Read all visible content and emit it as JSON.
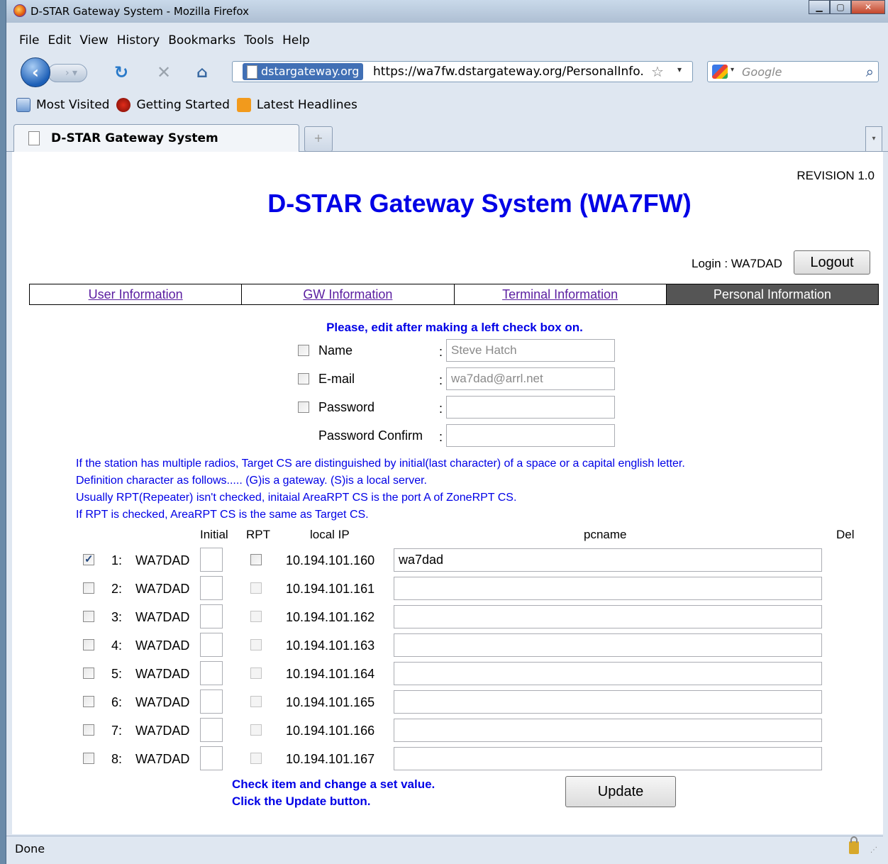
{
  "window": {
    "title": "D-STAR Gateway System - Mozilla Firefox"
  },
  "menu": [
    "File",
    "Edit",
    "View",
    "History",
    "Bookmarks",
    "Tools",
    "Help"
  ],
  "nav": {
    "site_identity": "dstargateway.org",
    "url": "https://wa7fw.dstargateway.org/PersonalInfo.",
    "search_placeholder": "Google"
  },
  "bookmarks": [
    "Most Visited",
    "Getting Started",
    "Latest Headlines"
  ],
  "tab": {
    "title": "D-STAR Gateway System",
    "new_tab": "+"
  },
  "page": {
    "revision": "REVISION 1.0",
    "title": "D-STAR Gateway System (WA7FW)",
    "login_label": "Login : WA7DAD",
    "logout": "Logout",
    "tabs": [
      "User Information",
      "GW Information",
      "Terminal Information",
      "Personal Information"
    ],
    "instruction": "Please, edit after making a left check box on.",
    "fields": {
      "name_label": "Name",
      "name_value": "Steve Hatch",
      "email_label": "E-mail",
      "email_value": "wa7dad@arrl.net",
      "password_label": "Password",
      "password_value": "",
      "confirm_label": "Password Confirm",
      "confirm_value": "",
      "colon": ":"
    },
    "notes": [
      "If the station has multiple radios, Target CS are distinguished by initial(last character) of a space or a capital english letter.",
      "Definition character as follows..... (G)is a gateway. (S)is a local server.",
      "Usually RPT(Repeater) isn't checked, initaial AreaRPT CS is the port A of ZoneRPT CS.",
      "If RPT is checked, AreaRPT CS is the same as Target CS."
    ],
    "headers": {
      "initial": "Initial",
      "rpt": "RPT",
      "local_ip": "local IP",
      "pcname": "pcname",
      "del": "Del"
    },
    "rows": [
      {
        "num": "1:",
        "cs": "WA7DAD",
        "ip": "10.194.101.160",
        "pcname": "wa7dad",
        "checked": true
      },
      {
        "num": "2:",
        "cs": "WA7DAD",
        "ip": "10.194.101.161",
        "pcname": "",
        "checked": false
      },
      {
        "num": "3:",
        "cs": "WA7DAD",
        "ip": "10.194.101.162",
        "pcname": "",
        "checked": false
      },
      {
        "num": "4:",
        "cs": "WA7DAD",
        "ip": "10.194.101.163",
        "pcname": "",
        "checked": false
      },
      {
        "num": "5:",
        "cs": "WA7DAD",
        "ip": "10.194.101.164",
        "pcname": "",
        "checked": false
      },
      {
        "num": "6:",
        "cs": "WA7DAD",
        "ip": "10.194.101.165",
        "pcname": "",
        "checked": false
      },
      {
        "num": "7:",
        "cs": "WA7DAD",
        "ip": "10.194.101.166",
        "pcname": "",
        "checked": false
      },
      {
        "num": "8:",
        "cs": "WA7DAD",
        "ip": "10.194.101.167",
        "pcname": "",
        "checked": false
      }
    ],
    "footer_note": [
      "Check item and change a set value.",
      "Click the Update button."
    ],
    "update": "Update"
  },
  "status": {
    "text": "Done"
  },
  "colors": {
    "title_blue": "#0000e6",
    "active_tab": "#555555",
    "link_visited": "#5a1da0"
  }
}
